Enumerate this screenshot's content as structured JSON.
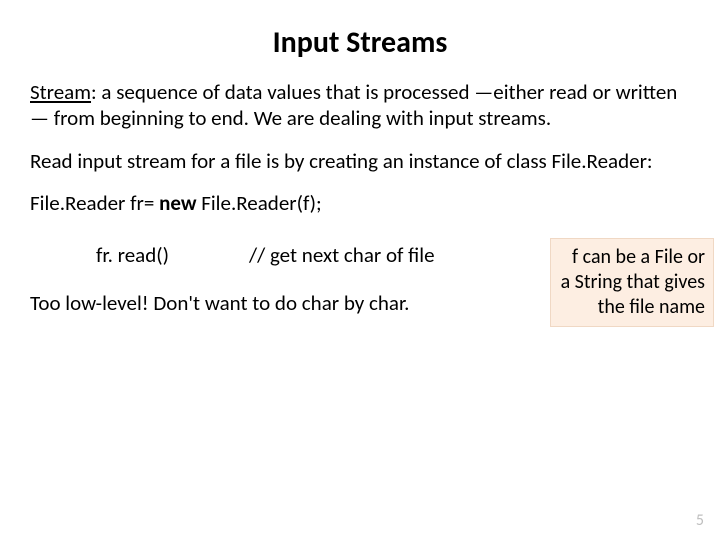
{
  "title": "Input Streams",
  "para1_term": "Stream",
  "para1_rest": ": a sequence of data values that is processed —either read or written— from beginning to end. We are dealing with input streams.",
  "para2": "Read input stream for a file is by creating an instance of class File.Reader:",
  "code_pre": "File.Reader fr= ",
  "code_kw": "new",
  "code_post": " File.Reader(f);",
  "read_call": "fr. read()",
  "read_comment": "// get next char of file",
  "para3": "Too low-level! Don't want to do char by char.",
  "sidebox": "f can be a File or a String that gives the file name",
  "pagenum": "5"
}
